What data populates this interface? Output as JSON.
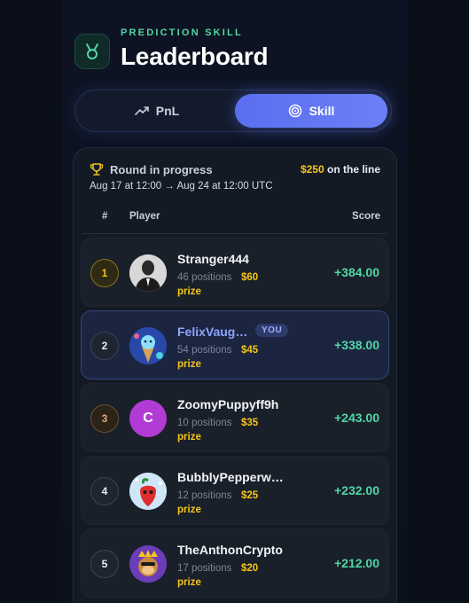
{
  "header": {
    "eyebrow": "PREDICTION SKILL",
    "title": "Leaderboard",
    "icon": "medal-icon"
  },
  "tabs": [
    {
      "label": "PnL",
      "icon": "trend-up-icon",
      "active": false
    },
    {
      "label": "Skill",
      "icon": "target-icon",
      "active": true
    }
  ],
  "round": {
    "status": "Round in progress",
    "amount": "$250",
    "amount_suffix": "on the line",
    "dates": "Aug 17 at 12:00 → Aug 24 at 12:00 UTC"
  },
  "columns": {
    "rank": "#",
    "player": "Player",
    "score": "Score"
  },
  "you_tag": "YOU",
  "prize_word": "prize",
  "rows": [
    {
      "rank": "1",
      "name": "Stranger444",
      "positions": "46 positions",
      "prize": "$60",
      "score": "+384.00",
      "avatar": "anonymous-suit-avatar"
    },
    {
      "rank": "2",
      "name": "FelixVaug…",
      "positions": "54 positions",
      "prize": "$45",
      "score": "+338.00",
      "avatar": "ice-cream-avatar",
      "you": true
    },
    {
      "rank": "3",
      "name": "ZoomyPuppyff9h",
      "positions": "10 positions",
      "prize": "$35",
      "score": "+243.00",
      "avatar_letter": "C"
    },
    {
      "rank": "4",
      "name": "BubblyPepperw…",
      "positions": "12 positions",
      "prize": "$25",
      "score": "+232.00",
      "avatar": "pepper-avatar"
    },
    {
      "rank": "5",
      "name": "TheAnthonCrypto",
      "positions": "17 positions",
      "prize": "$20",
      "score": "+212.00",
      "avatar": "monkey-avatar"
    }
  ],
  "colors": {
    "accent_green": "#4fd6a5",
    "accent_gold": "#f5c518",
    "accent_blue": "#6b7ff5",
    "background": "#0a0f1a"
  }
}
